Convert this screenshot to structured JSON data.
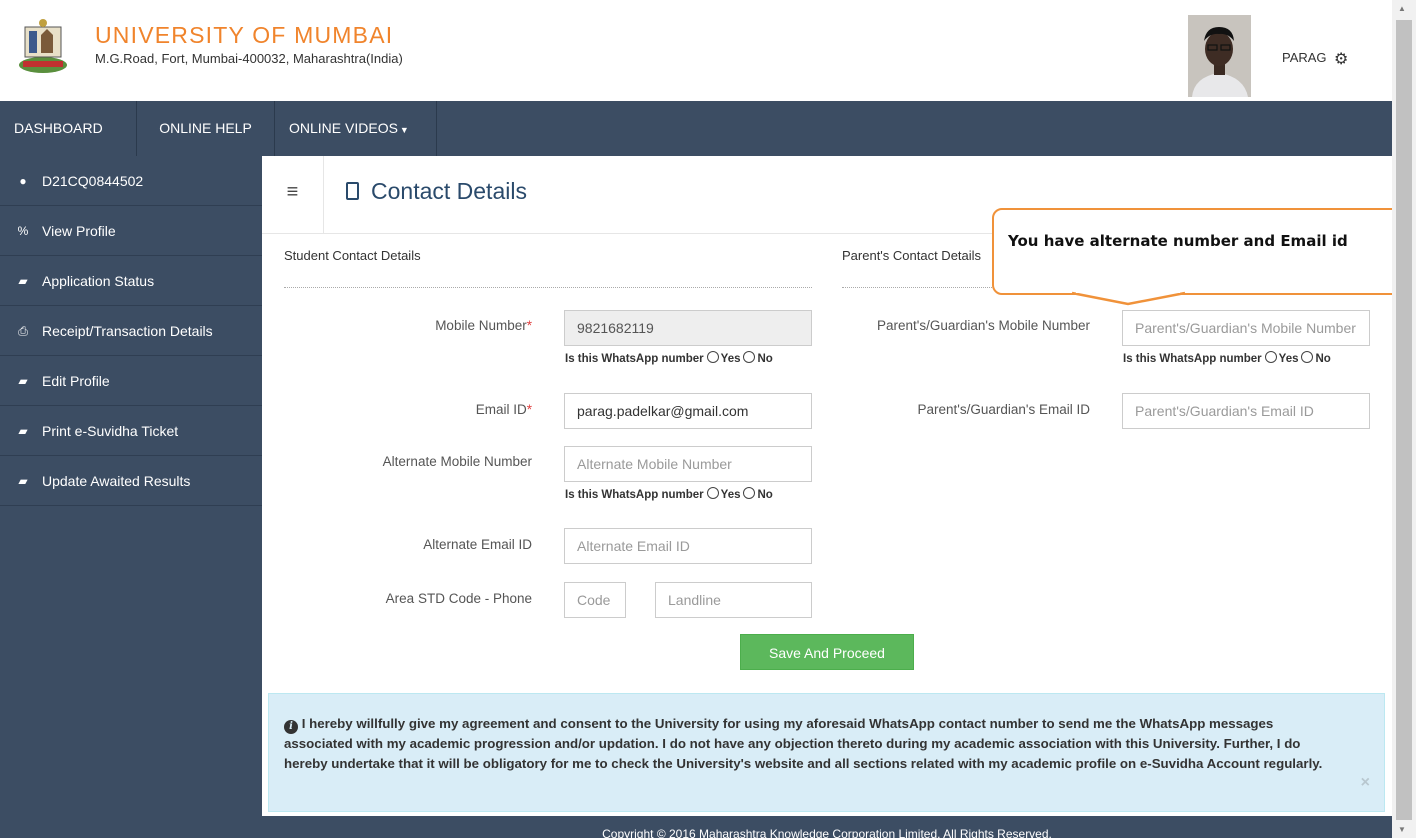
{
  "header": {
    "university_name": "UNIVERSITY OF MUMBAI",
    "address": "M.G.Road, Fort, Mumbai-400032, Maharashtra(India)",
    "user_name": "PARAG"
  },
  "navbar": {
    "items": [
      "DASHBOARD",
      "ONLINE HELP",
      "ONLINE VIDEOS"
    ]
  },
  "sidebar": {
    "items": [
      {
        "label": "D21CQ0844502",
        "icon": "user-icon"
      },
      {
        "label": "View Profile",
        "icon": "link-icon"
      },
      {
        "label": "Application Status",
        "icon": "folder-icon"
      },
      {
        "label": "Receipt/Transaction Details",
        "icon": "print-icon"
      },
      {
        "label": "Edit Profile",
        "icon": "folder-icon"
      },
      {
        "label": "Print e-Suvidha Ticket",
        "icon": "folder-icon"
      },
      {
        "label": "Update Awaited Results",
        "icon": "folder-icon"
      }
    ]
  },
  "page": {
    "title": "Contact Details"
  },
  "student": {
    "section_title": "Student Contact Details",
    "mobile_label": "Mobile Number",
    "mobile_value": "9821682119",
    "email_label": "Email ID",
    "email_value": "parag.padelkar@gmail.com",
    "alt_mobile_label": "Alternate Mobile Number",
    "alt_mobile_placeholder": "Alternate Mobile Number",
    "alt_email_label": "Alternate Email ID",
    "alt_email_placeholder": "Alternate Email ID",
    "phone_label": "Area STD Code - Phone",
    "code_placeholder": "Code",
    "landline_placeholder": "Landline"
  },
  "parent": {
    "section_title": "Parent's Contact Details",
    "mobile_label": "Parent's/Guardian's Mobile Number",
    "mobile_placeholder": "Parent's/Guardian's Mobile Number",
    "email_label": "Parent's/Guardian's Email ID",
    "email_placeholder": "Parent's/Guardian's Email ID"
  },
  "whatsapp": {
    "question": "Is this WhatsApp number",
    "yes": "Yes",
    "no": "No"
  },
  "required_mark": "*",
  "save_button": "Save And Proceed",
  "consent_text": "I hereby willfully give my agreement and consent to the University for using my aforesaid WhatsApp contact number to send me the WhatsApp messages associated with my academic progression and/or updation. I do not have any objection thereto during my academic association with this University. Further, I do hereby undertake that it will be obligatory for me to check the University's website and all sections related with my academic profile on e-Suvidha Account regularly.",
  "close_symbol": "×",
  "footer": "Copyright © 2016 Maharashtra Knowledge Corporation Limited. All Rights Reserved.",
  "annotation": "You have alternate number and Email id"
}
